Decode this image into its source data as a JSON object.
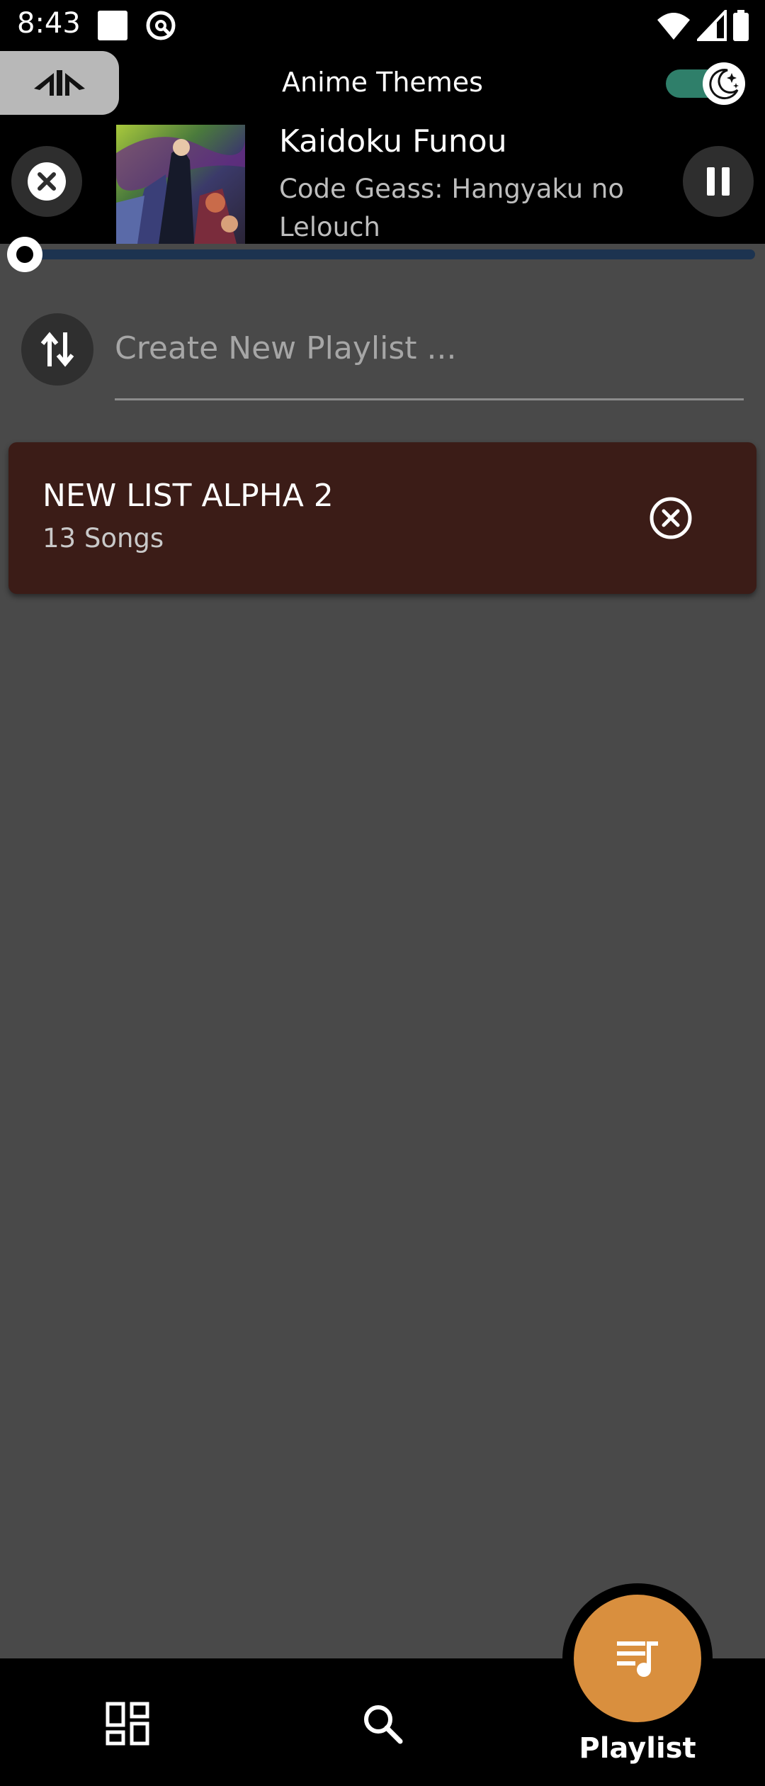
{
  "status_bar": {
    "time": "8:43",
    "icons": [
      "stop-square-icon",
      "at-circle-icon",
      "wifi-icon",
      "signal-icon",
      "battery-icon"
    ]
  },
  "header": {
    "title": "Anime Themes",
    "logo_icon": "app-logo-icon",
    "theme_toggle": {
      "state": "dark",
      "icon": "moon-stars-icon"
    }
  },
  "now_playing": {
    "title": "Kaidoku Funou",
    "subtitle": "Code Geass: Hangyaku no Lelouch",
    "progress": 0.0,
    "close_icon": "close-icon",
    "pause_icon": "pause-icon"
  },
  "create_playlist": {
    "placeholder": "Create New Playlist ...",
    "value": "",
    "sort_icon": "swap-vertical-icon"
  },
  "playlists": [
    {
      "name": "NEW LIST ALPHA 2",
      "count": "13 Songs",
      "delete_icon": "close-circle-outline-icon"
    }
  ],
  "bottom_nav": {
    "items": [
      {
        "icon": "dashboard-icon",
        "label": ""
      },
      {
        "icon": "search-icon",
        "label": ""
      },
      {
        "icon": "playlist-music-icon",
        "label": "Playlist",
        "active": true
      }
    ]
  },
  "colors": {
    "background": "#494949",
    "bar": "#000000",
    "accent": "#d98f3e",
    "card": "#3b1c17",
    "toggle": "#2f7f6a",
    "progress_track": "#1c3350"
  }
}
